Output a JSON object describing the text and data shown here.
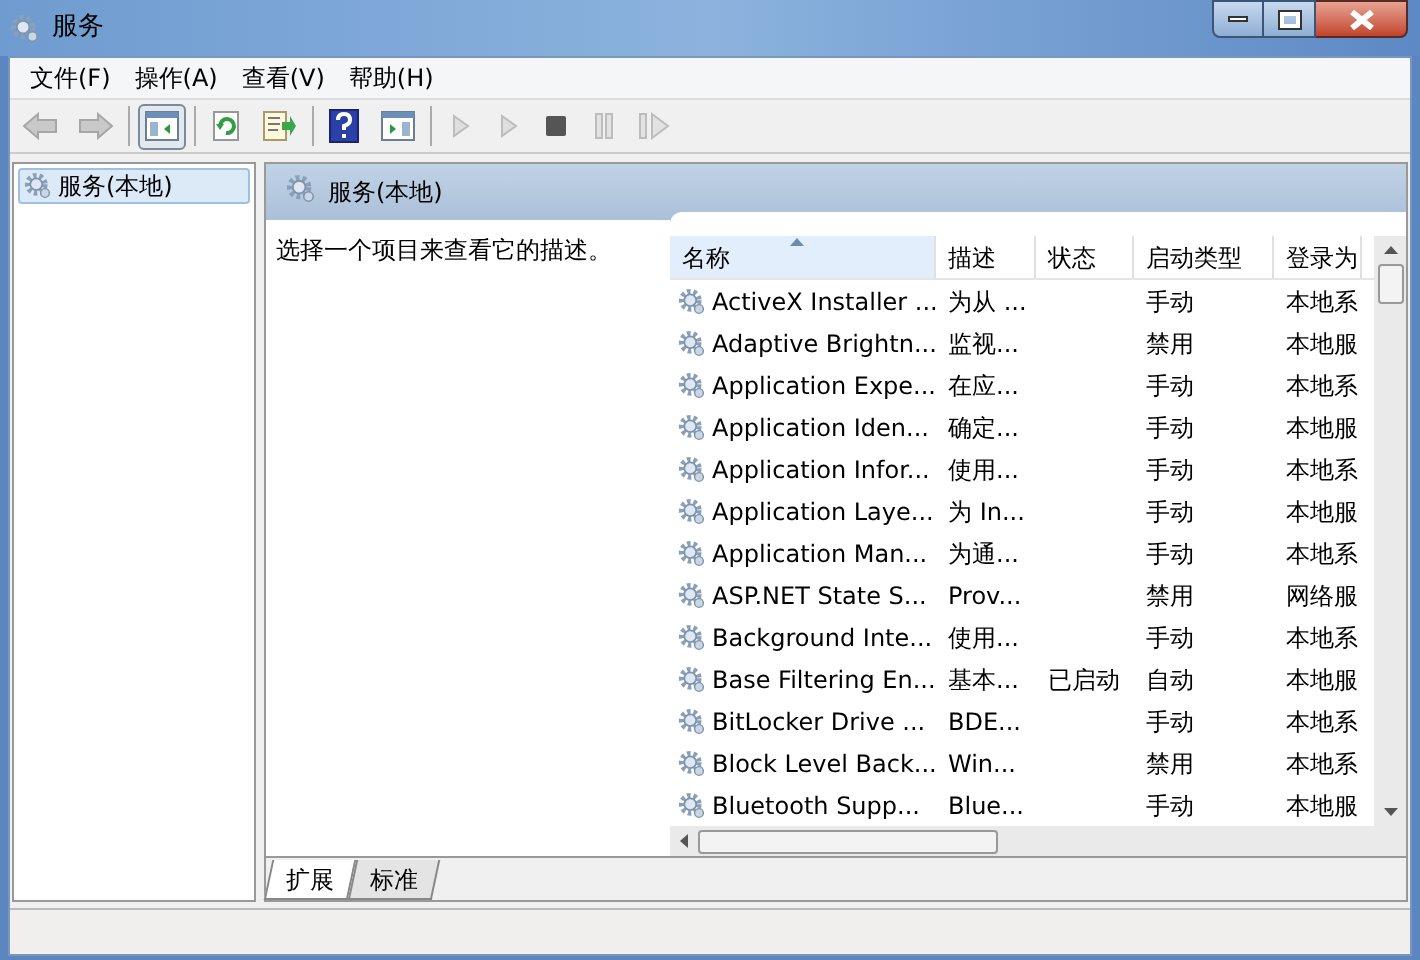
{
  "window": {
    "title": "服务"
  },
  "menu": [
    "文件(F)",
    "操作(A)",
    "查看(V)",
    "帮助(H)"
  ],
  "toolbar": [
    {
      "kind": "back",
      "disabled": true,
      "pressed": false
    },
    {
      "kind": "forward",
      "disabled": true,
      "pressed": false
    },
    {
      "kind": "sep"
    },
    {
      "kind": "tree",
      "disabled": false,
      "pressed": true
    },
    {
      "kind": "sep"
    },
    {
      "kind": "refresh",
      "disabled": false,
      "pressed": false
    },
    {
      "kind": "export",
      "disabled": false,
      "pressed": false
    },
    {
      "kind": "sep"
    },
    {
      "kind": "help",
      "disabled": false,
      "pressed": false
    },
    {
      "kind": "pane",
      "disabled": false,
      "pressed": false
    },
    {
      "kind": "sep"
    },
    {
      "kind": "play",
      "disabled": true,
      "pressed": false
    },
    {
      "kind": "play",
      "disabled": true,
      "pressed": false
    },
    {
      "kind": "stop",
      "disabled": false,
      "pressed": false
    },
    {
      "kind": "pause",
      "disabled": true,
      "pressed": false
    },
    {
      "kind": "resume",
      "disabled": true,
      "pressed": false
    }
  ],
  "tree": [
    {
      "label": "服务(本地)",
      "selected": true
    }
  ],
  "pane": {
    "title": "服务(本地)",
    "description": "选择一个项目来查看它的描述。"
  },
  "table": {
    "columns": [
      "名称",
      "描述",
      "状态",
      "启动类型",
      "登录为"
    ],
    "rows": [
      [
        "ActiveX Installer ...",
        "为从 ...",
        "",
        "手动",
        "本地系"
      ],
      [
        "Adaptive Brightn...",
        "监视...",
        "",
        "禁用",
        "本地服"
      ],
      [
        "Application Expe...",
        "在应...",
        "",
        "手动",
        "本地系"
      ],
      [
        "Application Iden...",
        "确定...",
        "",
        "手动",
        "本地服"
      ],
      [
        "Application Infor...",
        "使用...",
        "",
        "手动",
        "本地系"
      ],
      [
        "Application Laye...",
        "为 In...",
        "",
        "手动",
        "本地服"
      ],
      [
        "Application Man...",
        "为通...",
        "",
        "手动",
        "本地系"
      ],
      [
        "ASP.NET State S...",
        "Prov...",
        "",
        "禁用",
        "网络服"
      ],
      [
        "Background Inte...",
        "使用...",
        "",
        "手动",
        "本地系"
      ],
      [
        "Base Filtering En...",
        "基本...",
        "已启动",
        "自动",
        "本地服"
      ],
      [
        "BitLocker Drive ...",
        "BDE...",
        "",
        "手动",
        "本地系"
      ],
      [
        "Block Level Back...",
        "Win...",
        "",
        "禁用",
        "本地系"
      ],
      [
        "Bluetooth Supp...",
        "Blue...",
        "",
        "手动",
        "本地服"
      ]
    ]
  },
  "tabs": [
    {
      "label": "扩展",
      "selected": true
    },
    {
      "label": "标准",
      "selected": false
    }
  ]
}
